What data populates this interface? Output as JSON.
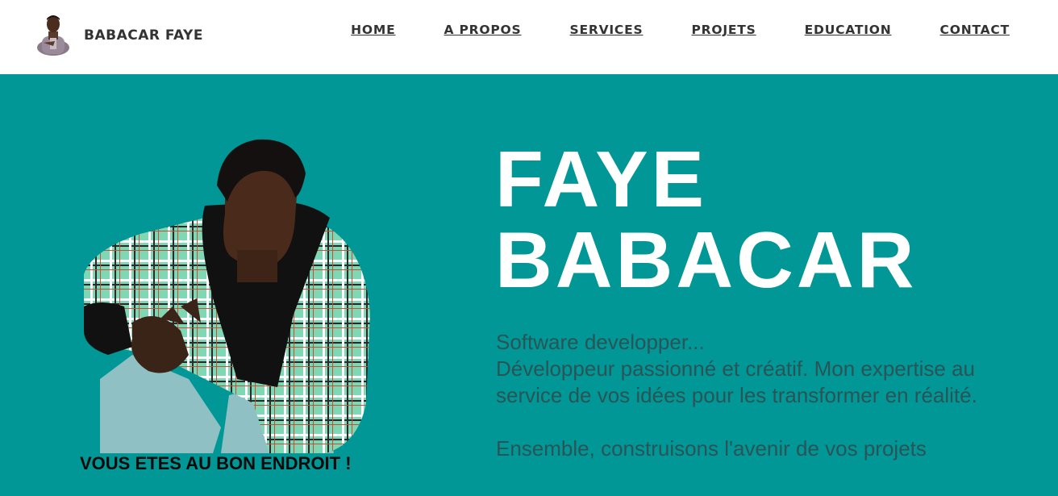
{
  "brand": {
    "name": "BABACAR FAYE"
  },
  "nav": {
    "items": [
      {
        "label": "HOME"
      },
      {
        "label": "A PROPOS"
      },
      {
        "label": "SERVICES"
      },
      {
        "label": "PROJETS"
      },
      {
        "label": "EDUCATION"
      },
      {
        "label": "CONTACT"
      }
    ]
  },
  "hero": {
    "title_line1": "FAYE",
    "title_line2": "BABACAR",
    "subtitle": "Software developper...",
    "description": "Développeur passionné et créatif. Mon expertise au service de vos idées pour les transformer en réalité.",
    "cta_text": "Ensemble, construisons l'avenir de vos projets",
    "tagline": "VOUS ETES AU BON ENDROIT !"
  },
  "colors": {
    "hero_background": "#009796",
    "navbar_background": "#ffffff",
    "nav_text": "#333333",
    "title_text": "#ffffff",
    "description_text": "#2b5456"
  }
}
